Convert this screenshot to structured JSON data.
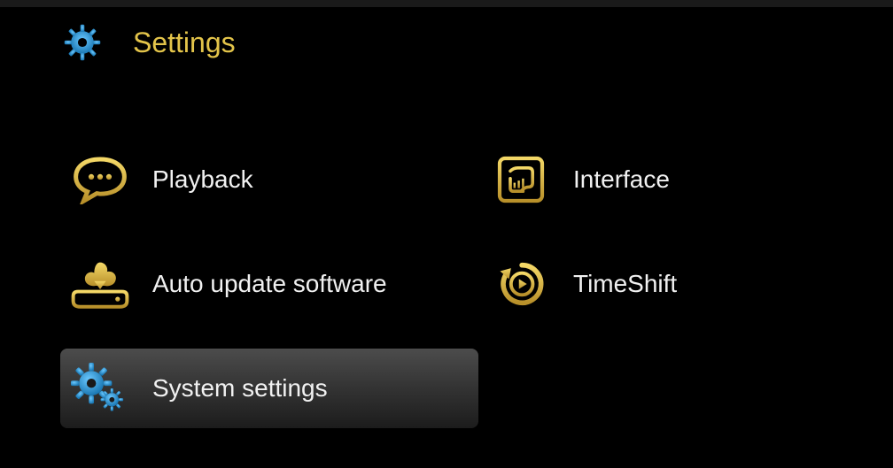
{
  "header": {
    "title": "Settings"
  },
  "colors": {
    "accent": "#e3c44a",
    "accent_dark": "#b9962a",
    "highlight": "#3da9e3",
    "text": "#f1f1f1"
  },
  "menu": {
    "items": [
      {
        "icon": "speech-icon",
        "label": "Playback",
        "selected": false
      },
      {
        "icon": "interface-icon",
        "label": "Interface",
        "selected": false
      },
      {
        "icon": "download-icon",
        "label": "Auto update software",
        "selected": false
      },
      {
        "icon": "timeshift-icon",
        "label": "TimeShift",
        "selected": false
      },
      {
        "icon": "gears-icon",
        "label": "System settings",
        "selected": true
      }
    ]
  }
}
